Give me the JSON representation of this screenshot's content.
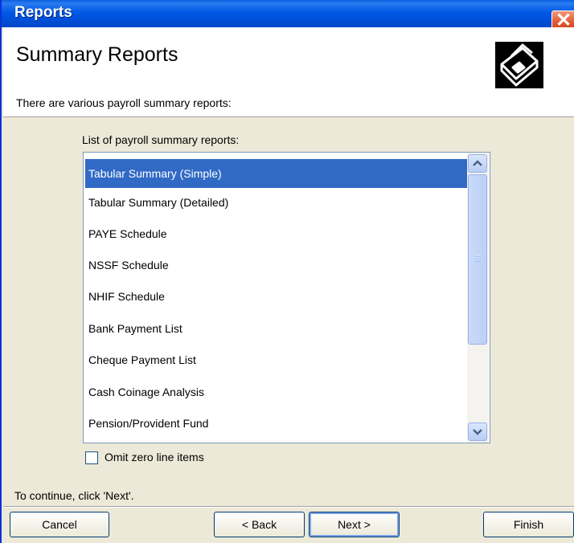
{
  "window": {
    "title": "Reports"
  },
  "header": {
    "title": "Summary Reports",
    "description": "There are various payroll summary reports:",
    "logo_icon": "printer-icon"
  },
  "list": {
    "caption": "List of payroll summary reports:",
    "selected_index": 0,
    "items": [
      "Tabular Summary (Simple)",
      "Tabular Summary (Detailed)",
      "PAYE Schedule",
      "NSSF Schedule",
      "NHIF  Schedule",
      "Bank Payment List",
      "Cheque Payment List",
      "Cash Coinage Analysis",
      "Pension/Provident Fund"
    ]
  },
  "option": {
    "omit_zero_label": "Omit zero line items",
    "omit_zero_checked": false
  },
  "footer": {
    "instruction": "To continue, click 'Next'.",
    "cancel_label": "Cancel",
    "back_label": "< Back",
    "next_label": "Next >",
    "finish_label": "Finish"
  },
  "colors": {
    "selection": "#316ac5",
    "titlebar": "#0058e6",
    "close": "#e0552f"
  }
}
